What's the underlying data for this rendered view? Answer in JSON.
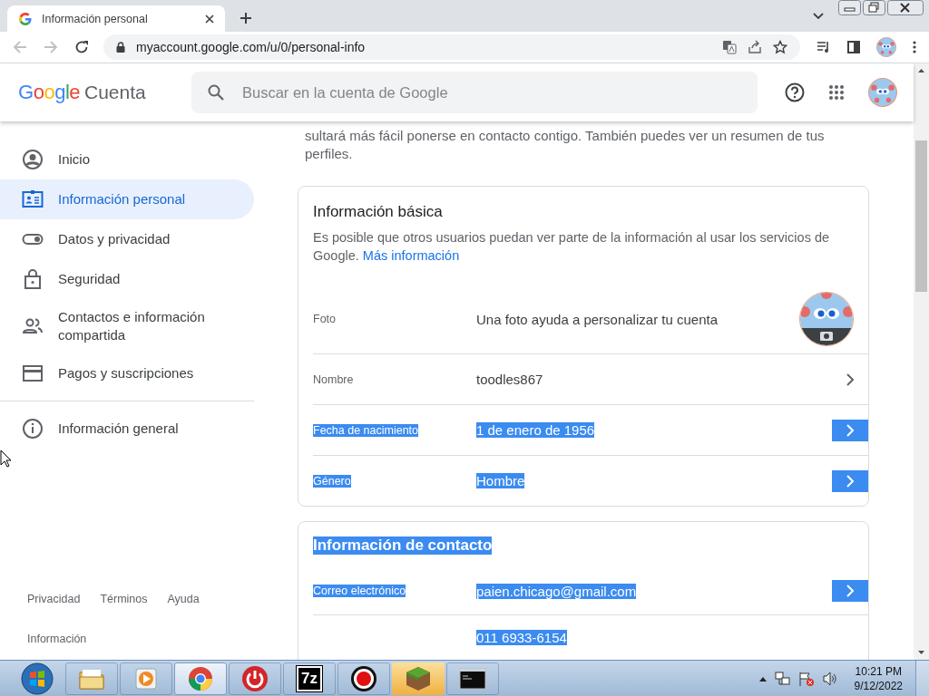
{
  "browser": {
    "tab_title": "Información personal",
    "url": "myaccount.google.com/u/0/personal-info"
  },
  "header": {
    "logo": "Google",
    "product": "Cuenta",
    "search": {
      "placeholder": "Buscar en la cuenta de Google"
    }
  },
  "sidebar": {
    "items": [
      {
        "label": "Inicio",
        "selected": false
      },
      {
        "label": "Información personal",
        "selected": true
      },
      {
        "label": "Datos y privacidad",
        "selected": false
      },
      {
        "label": "Seguridad",
        "selected": false
      },
      {
        "label": "Contactos e información compartida",
        "selected": false
      },
      {
        "label": "Pagos y suscripciones",
        "selected": false
      },
      {
        "label": "Información general",
        "selected": false
      }
    ],
    "footer_links": [
      "Privacidad",
      "Términos",
      "Ayuda",
      "Información"
    ]
  },
  "intro": "sultará más fácil ponerse en contacto contigo. También puedes ver un resumen de tus perfiles.",
  "basic_info": {
    "title": "Información básica",
    "description": "Es posible que otros usuarios puedan ver parte de la información al usar los servicios de Google.",
    "link": "Más información",
    "rows": [
      {
        "kind": "photo",
        "label": "Foto",
        "value": "Una foto ayuda a personalizar tu cuenta",
        "highlighted": false
      },
      {
        "kind": "field",
        "label": "Nombre",
        "value": "toodles867",
        "highlighted": false
      },
      {
        "kind": "field",
        "label": "Fecha de nacimiento",
        "value": "1 de enero de 1956",
        "highlighted": true
      },
      {
        "kind": "field",
        "label": "Género",
        "value": "Hombre",
        "highlighted": true
      }
    ]
  },
  "contact_info": {
    "title": "Información de contacto",
    "title_highlighted": true,
    "rows": [
      {
        "kind": "field",
        "label": "Correo electrónico",
        "value": "paien.chicago@gmail.com",
        "highlighted": true
      },
      {
        "kind": "partial",
        "value": "011 6933-6154",
        "highlighted": true
      }
    ]
  },
  "taskbar": {
    "archiver_label": "7z",
    "clock": {
      "time": "10:21 PM",
      "date": "9/12/2022"
    }
  }
}
